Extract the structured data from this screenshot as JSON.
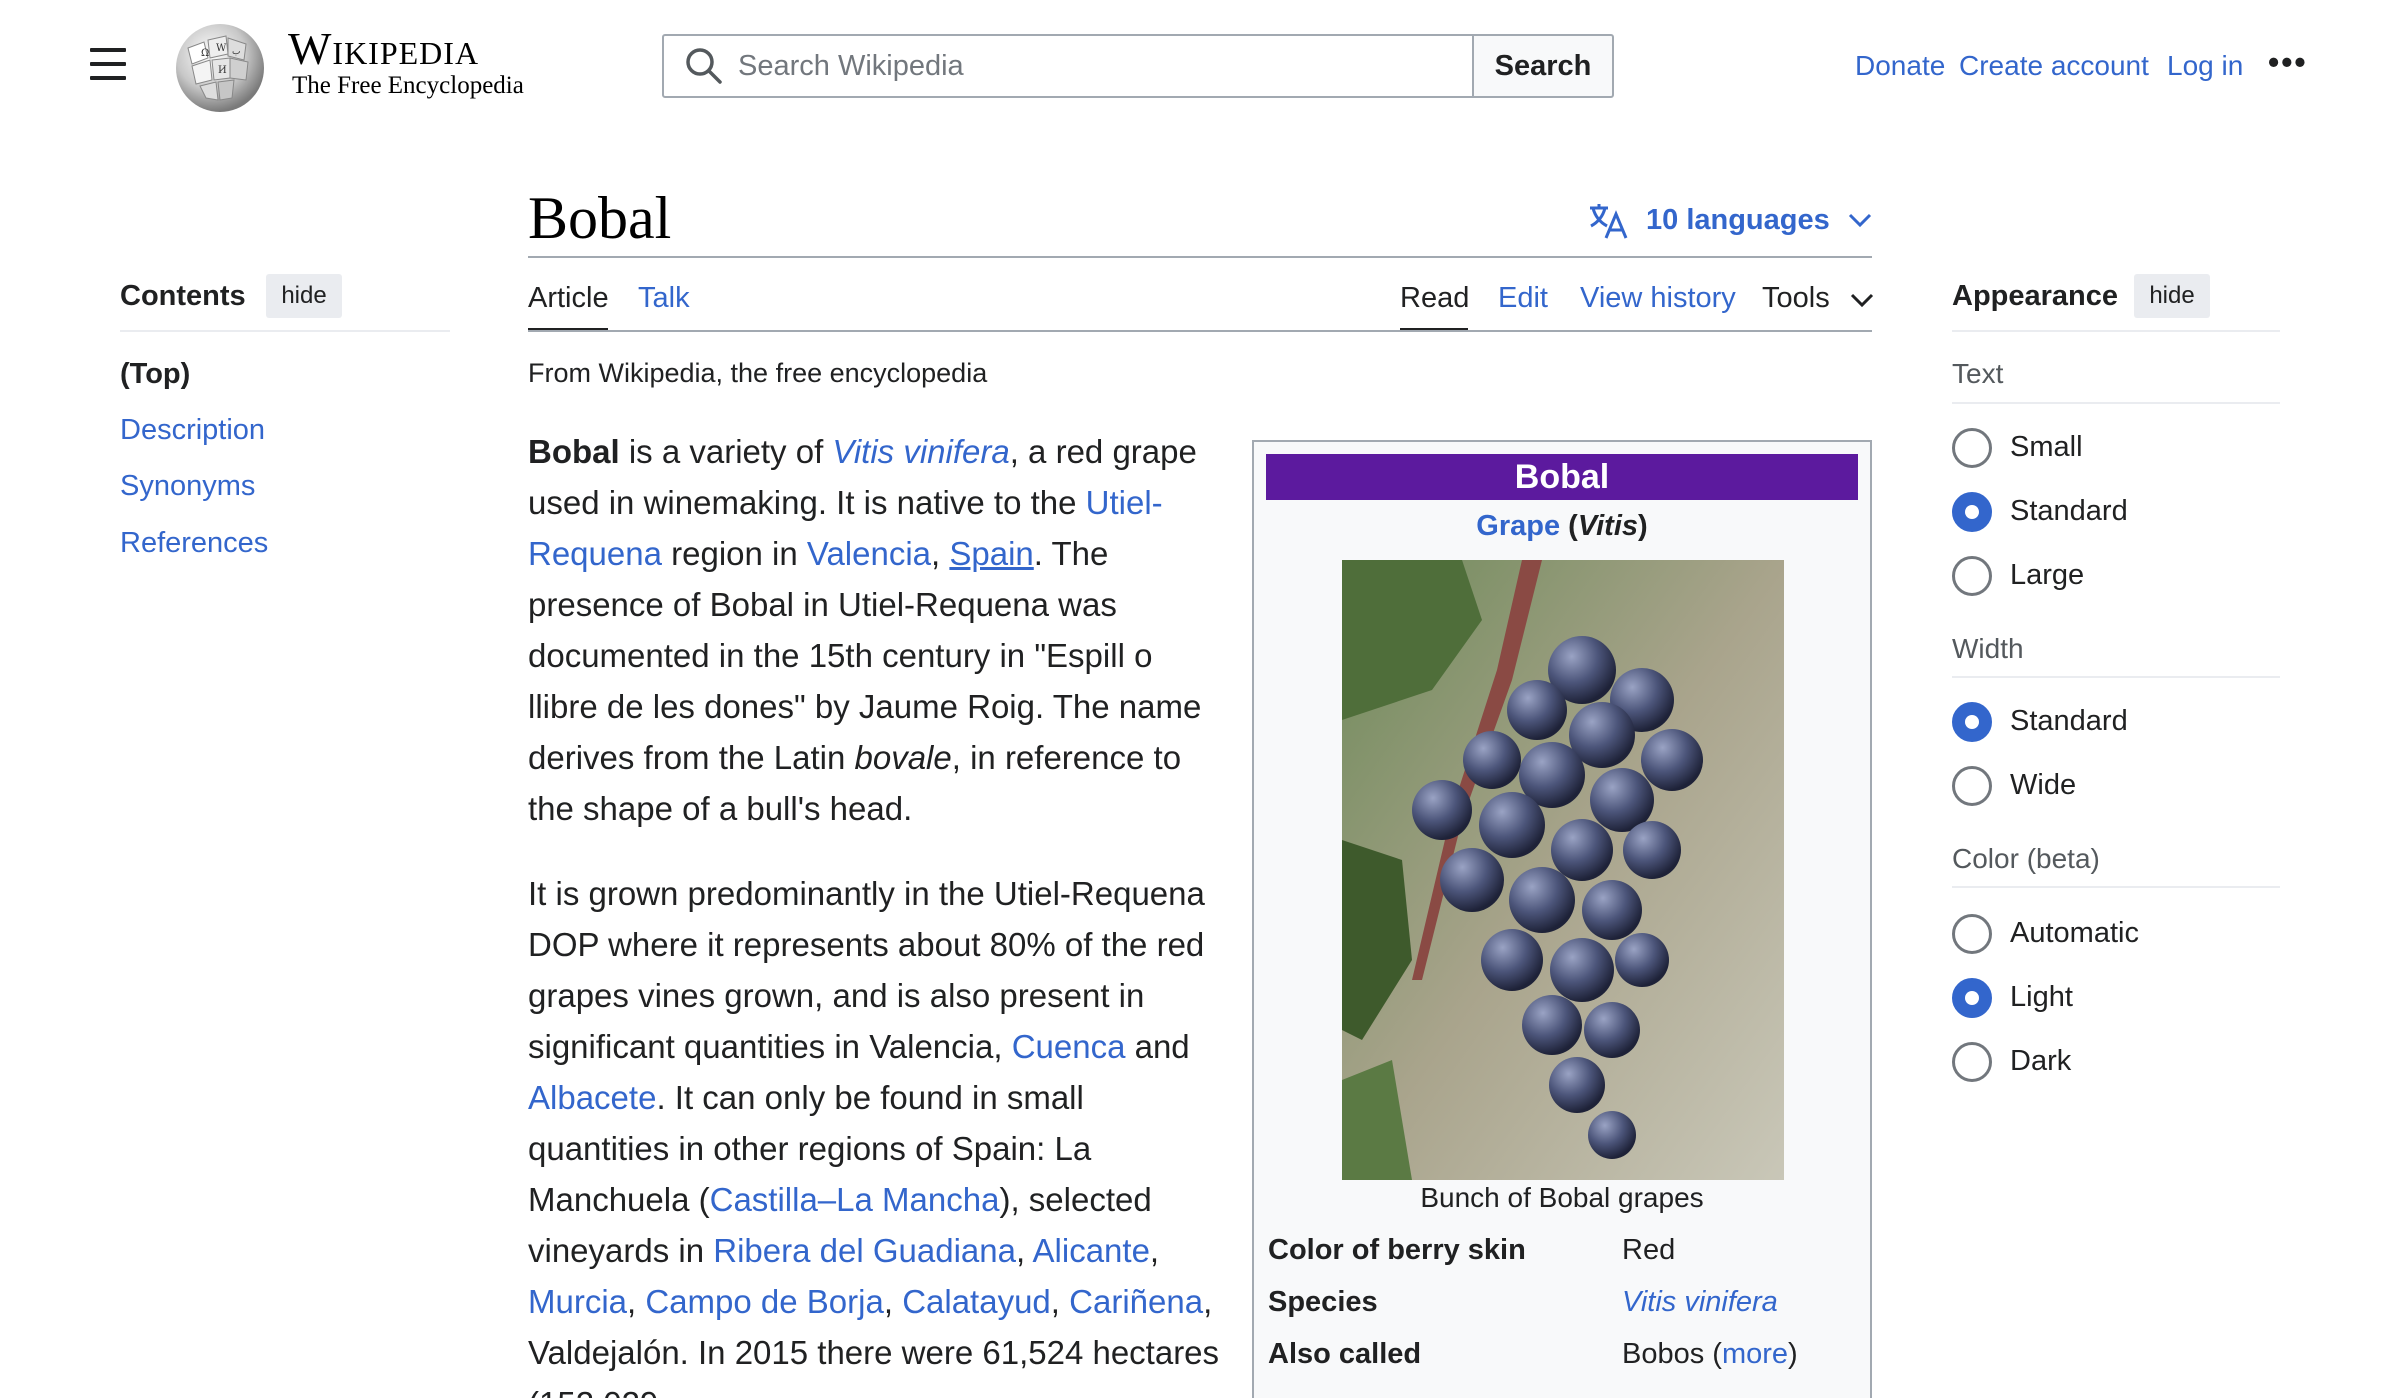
{
  "header": {
    "wordmark": "Wikipedia",
    "tagline": "The Free Encyclopedia",
    "search_placeholder": "Search Wikipedia",
    "search_button": "Search",
    "donate": "Donate",
    "create_account": "Create account",
    "login": "Log in",
    "more": "•••"
  },
  "toc": {
    "title": "Contents",
    "hide": "hide",
    "items": [
      "(Top)",
      "Description",
      "Synonyms",
      "References"
    ]
  },
  "article": {
    "title": "Bobal",
    "languages": "10 languages",
    "tabs": {
      "article": "Article",
      "talk": "Talk",
      "read": "Read",
      "edit": "Edit",
      "history": "View history",
      "tools": "Tools"
    },
    "from": "From Wikipedia, the free encyclopedia"
  },
  "infobox": {
    "title": "Bobal",
    "subtitle_link": "Grape",
    "subtitle_genus": "Vitis",
    "caption": "Bunch of Bobal grapes",
    "rows": [
      {
        "label": "Color of berry skin",
        "value": "Red"
      },
      {
        "label": "Species",
        "value": "Vitis vinifera"
      },
      {
        "label": "Also called",
        "value": "Bobos",
        "link": "more"
      }
    ]
  },
  "appearance": {
    "title": "Appearance",
    "hide": "hide",
    "text_label": "Text",
    "text_options": [
      "Small",
      "Standard",
      "Large"
    ],
    "text_selected": "Standard",
    "width_label": "Width",
    "width_options": [
      "Standard",
      "Wide"
    ],
    "width_selected": "Standard",
    "color_label": "Color (beta)",
    "color_options": [
      "Automatic",
      "Light",
      "Dark"
    ],
    "color_selected": "Light"
  },
  "colors": {
    "link": "#3366cc",
    "infobox_header": "#5c1a9e",
    "text": "#202122"
  }
}
